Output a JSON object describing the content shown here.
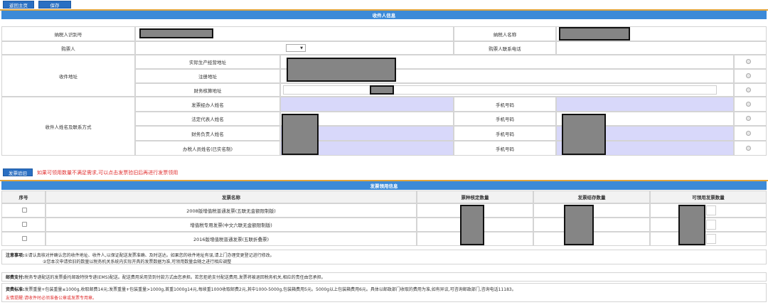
{
  "toolbar": {
    "back_label": "返回主页",
    "save_label": "保存"
  },
  "recipient": {
    "section_title": "收件人信息",
    "taxpayer_id_label": "纳税人识别号",
    "taxpayer_name_label": "纳税人名称",
    "buyer_label": "购票人",
    "buyer_phone_label": "购票人联系电话",
    "buyer_select_value": "",
    "address_label": "收件地址",
    "address_options": [
      "实际生产经营地址",
      "注册地址",
      "财务核算地址"
    ],
    "contacts_label": "收件人姓名及联系方式",
    "contacts": [
      "发票经办人姓名",
      "法定代表人姓名",
      "财务负责人姓名",
      "办税人员姓名(已实名制)"
    ],
    "phone_label": "手机号码"
  },
  "verify": {
    "button_label": "发票验旧",
    "tip": "如果可领用数量不满足需求,可以点击发票验旧后再进行发票领用"
  },
  "invoice": {
    "section_title": "发票领用信息",
    "headers": [
      "序号",
      "发票名称",
      "票种核定数量",
      "发票结存数量",
      "可领用发票数量"
    ],
    "rows": [
      {
        "name": "2008版增值税普通发票(五联无金额限制版)"
      },
      {
        "name": "增值税专用发票(中文六联无金额限制版)"
      },
      {
        "name": "2016版增值税普通发票(五联折叠票)"
      }
    ]
  },
  "notes": {
    "attention_title": "注意事项:",
    "attention_1": "①请认真核对并确认您的收件地址、收件人,以保证配送发票准确、及时送达。如果您的收件地址有误,请上门办理变更登记进行修改。",
    "attention_2": "②您本次申请验旧的数量以税务机关系统内实际开具的发票数据为准,可领用数量会随之进行相应调整",
    "postal_title": "邮费支付:",
    "postal_text": "税务专递配送的发票委托邮政特快专递(EMS)配送。配送费用采用货到付款方式由您承担。若您拒绝支付配送费用,发票将被退回税务机关,相应的责任由您承担。",
    "fee_title": "资费标准:",
    "fee_text": "发票重量+包装重量≤1000g,收取邮费14元;发票重量+包装重量>1000g,首重1000g14元,每续重1000收取邮费2元,其中1000-5000g,包装箱费用5元。5000g以上包装箱费用6元。具体以邮政部门收取的费用为准,如有异议,可咨询邮政部门,咨询电话11183。",
    "warm_tip": "友情提醒:请收件时必须准备公章或发票专用章。"
  }
}
